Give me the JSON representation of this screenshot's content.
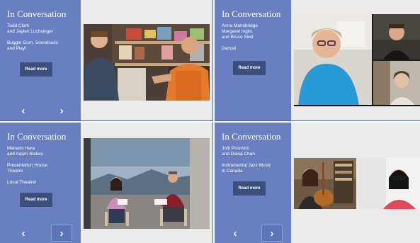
{
  "cards": [
    {
      "title": "In Conversation",
      "lines": [
        "Todd Clark",
        "and Jaylen Luchsinger",
        "",
        "Buggle Gum, Soundsuits",
        "and Play!"
      ],
      "button": "Read more",
      "prev_icon": "chevron-left-icon",
      "next_icon": "chevron-right-icon",
      "prev_glyph": "‹",
      "next_glyph": "›"
    },
    {
      "title": "In Conversation",
      "lines": [
        "Anna Mansbridge",
        "Margaret Inglis",
        "and Bruce Sled",
        "",
        "Dance!"
      ],
      "button": "Read more"
    },
    {
      "title": "In Conversation",
      "lines": [
        "Manami Hara",
        "and Adam Stokes",
        "",
        "Presentation House",
        "Theatre",
        "",
        "Local Theatre!"
      ],
      "button": "Read more",
      "prev_icon": "chevron-left-icon",
      "next_icon": "chevron-right-icon",
      "prev_glyph": "‹",
      "next_glyph": "›"
    },
    {
      "title": "In Conversation",
      "lines": [
        "Jodi Proznick",
        "and Diana Chan",
        "",
        "Instrumental Jazz Music",
        "in Canada"
      ],
      "button": "Read more",
      "prev_icon": "chevron-left-icon",
      "next_icon": "chevron-right-icon",
      "prev_glyph": "‹",
      "next_glyph": "›"
    }
  ],
  "colors": {
    "panel": "#6a7fc2",
    "button": "#3d4f7d",
    "media_background": "#ebebeb"
  }
}
